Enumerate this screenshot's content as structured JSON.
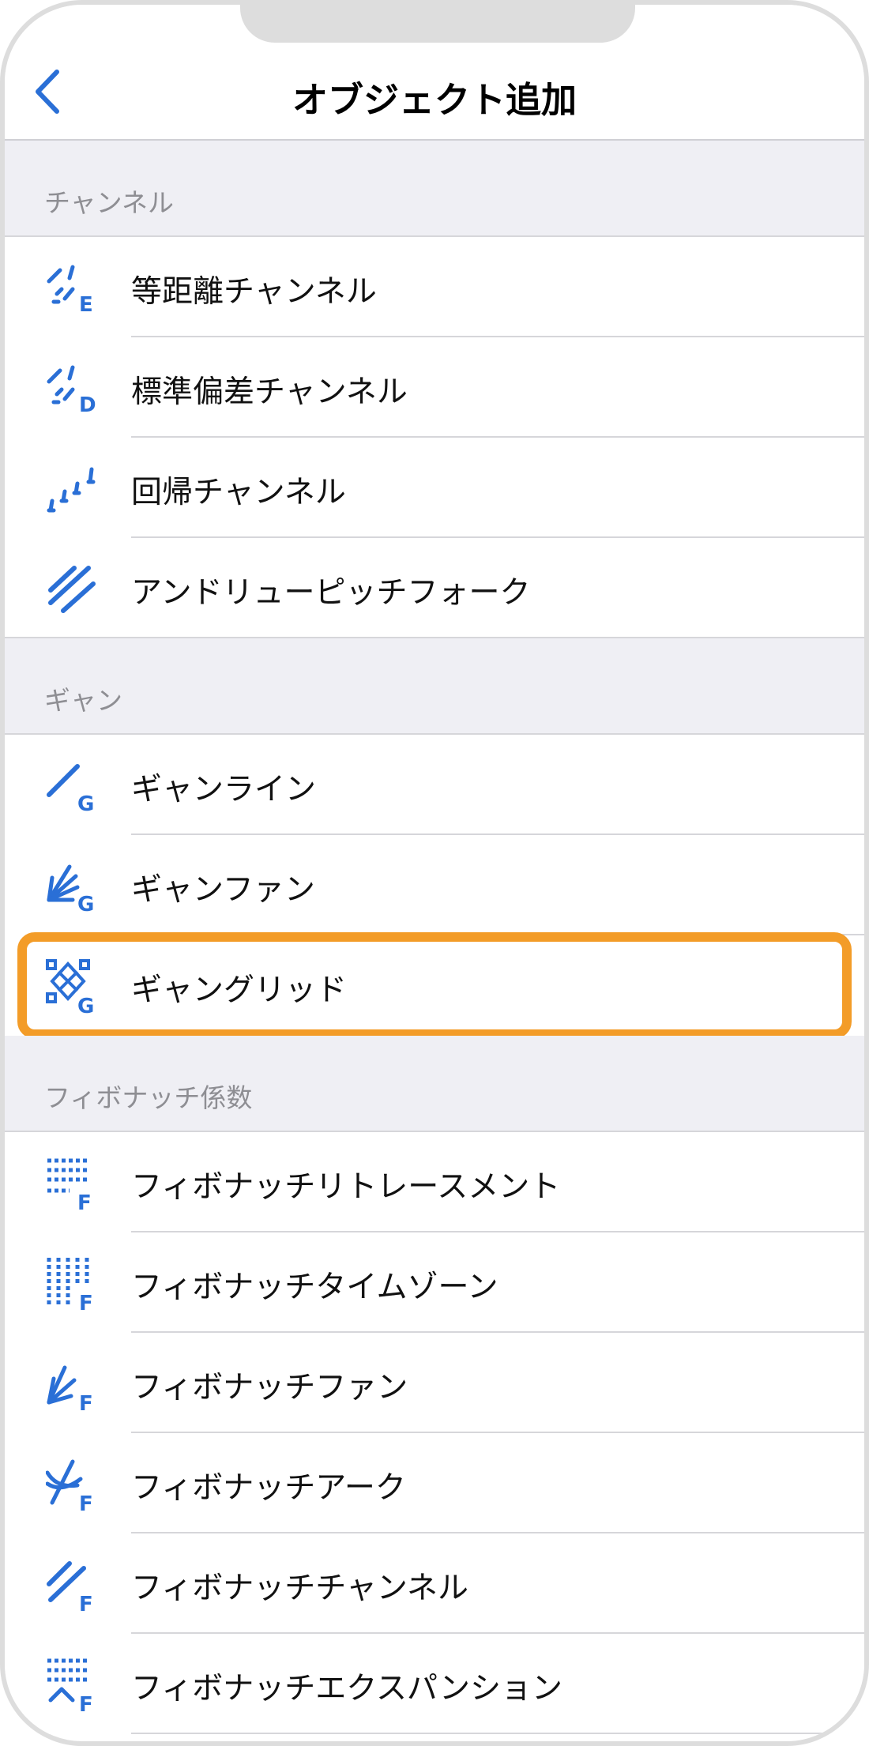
{
  "nav": {
    "title": "オブジェクト追加",
    "back_icon": "chevron-left-icon"
  },
  "colors": {
    "accent": "#2A6FD6",
    "highlight": "#F39C28",
    "section_bg": "#EFEFF4",
    "section_text": "#8E8E93"
  },
  "sections": [
    {
      "header": "チャンネル",
      "items": [
        {
          "label": "等距離チャンネル",
          "icon": "equidistant-channel-icon"
        },
        {
          "label": "標準偏差チャンネル",
          "icon": "std-deviation-channel-icon"
        },
        {
          "label": "回帰チャンネル",
          "icon": "regression-channel-icon"
        },
        {
          "label": "アンドリューピッチフォーク",
          "icon": "andrews-pitchfork-icon"
        }
      ]
    },
    {
      "header": "ギャン",
      "items": [
        {
          "label": "ギャンライン",
          "icon": "gann-line-icon"
        },
        {
          "label": "ギャンファン",
          "icon": "gann-fan-icon"
        },
        {
          "label": "ギャングリッド",
          "icon": "gann-grid-icon",
          "highlighted": true
        }
      ]
    },
    {
      "header": "フィボナッチ係数",
      "items": [
        {
          "label": "フィボナッチリトレースメント",
          "icon": "fibonacci-retracement-icon"
        },
        {
          "label": "フィボナッチタイムゾーン",
          "icon": "fibonacci-time-zones-icon"
        },
        {
          "label": "フィボナッチファン",
          "icon": "fibonacci-fan-icon"
        },
        {
          "label": "フィボナッチアーク",
          "icon": "fibonacci-arc-icon"
        },
        {
          "label": "フィボナッチチャンネル",
          "icon": "fibonacci-channel-icon"
        },
        {
          "label": "フィボナッチエクスパンション",
          "icon": "fibonacci-expansion-icon"
        }
      ]
    }
  ]
}
